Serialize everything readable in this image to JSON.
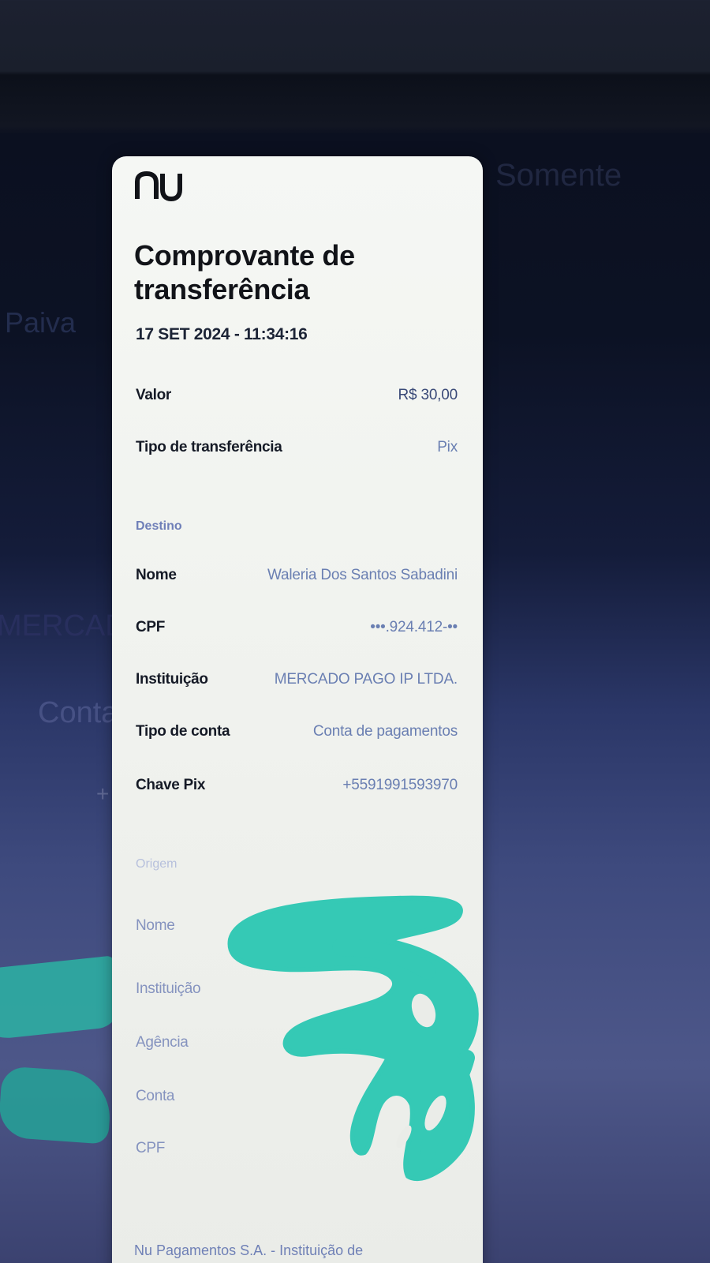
{
  "background": {
    "left_text_1": "Paiva",
    "right_text": "Somente",
    "left_text_2": "MERCAD",
    "left_text_3": "Conta",
    "plus": "+"
  },
  "receipt": {
    "logo": "nu",
    "title": "Comprovante de transferência",
    "datetime": "17 SET 2024 - 11:34:16",
    "valor": {
      "label": "Valor",
      "value": "R$ 30,00"
    },
    "tipo": {
      "label": "Tipo de transferência",
      "value": "Pix"
    },
    "destino": {
      "heading": "Destino",
      "nome": {
        "label": "Nome",
        "value": "Waleria Dos Santos Sabadini"
      },
      "cpf": {
        "label": "CPF",
        "value": "•••.924.412-••"
      },
      "instituicao": {
        "label": "Instituição",
        "value": "MERCADO PAGO IP LTDA."
      },
      "tipo_conta": {
        "label": "Tipo de conta",
        "value": "Conta de pagamentos"
      },
      "chave": {
        "label": "Chave Pix",
        "value": "+5591991593970"
      }
    },
    "origem": {
      "heading": "Origem",
      "nome": {
        "label": "Nome"
      },
      "instituicao": {
        "label": "Instituição"
      },
      "agencia": {
        "label": "Agência"
      },
      "conta": {
        "label": "Conta"
      },
      "cpf": {
        "label": "CPF"
      }
    },
    "footer": "Nu Pagamentos S.A. - Instituição de"
  },
  "colors": {
    "brand": "#111318",
    "value_blue": "#6a7fb2",
    "redaction_teal": "#35c9b5"
  }
}
